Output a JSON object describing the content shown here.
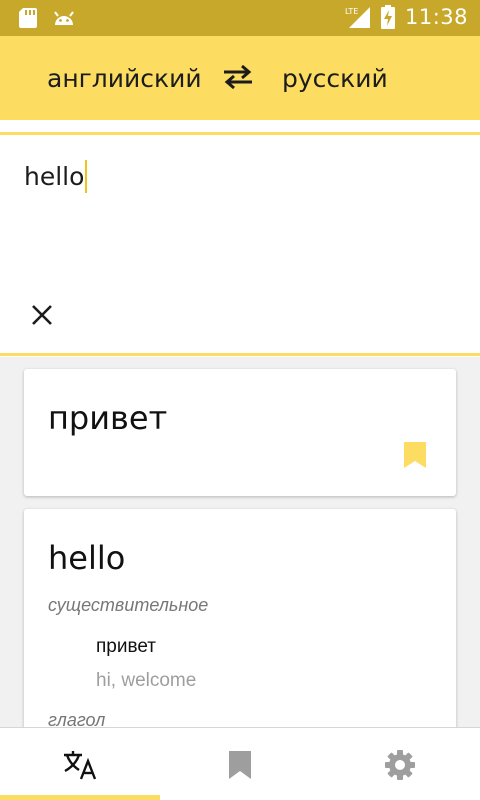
{
  "status_bar": {
    "time": "11:38",
    "network": "LTE"
  },
  "toolbar": {
    "source_language": "английский",
    "target_language": "русский",
    "swap_icon": "swap-arrows-icon"
  },
  "input": {
    "text": "hello",
    "clear_icon": "close-icon"
  },
  "translation": {
    "text": "привет",
    "bookmark_icon": "bookmark-icon"
  },
  "dictionary": {
    "word": "hello",
    "entries": [
      {
        "part_of_speech": "существительное",
        "translation": "привет",
        "synonyms": "hi, welcome"
      },
      {
        "part_of_speech": "глагол"
      }
    ]
  },
  "bottom_nav": {
    "items": [
      {
        "icon": "translate-icon",
        "active": true
      },
      {
        "icon": "bookmark-icon",
        "active": false
      },
      {
        "icon": "gear-icon",
        "active": false
      }
    ]
  },
  "colors": {
    "accent": "#fcdc61",
    "status_bar": "#c8a82a",
    "caret": "#f2c21c",
    "muted_text": "#9e9e9e",
    "inactive_icon": "#9e9e9e"
  }
}
